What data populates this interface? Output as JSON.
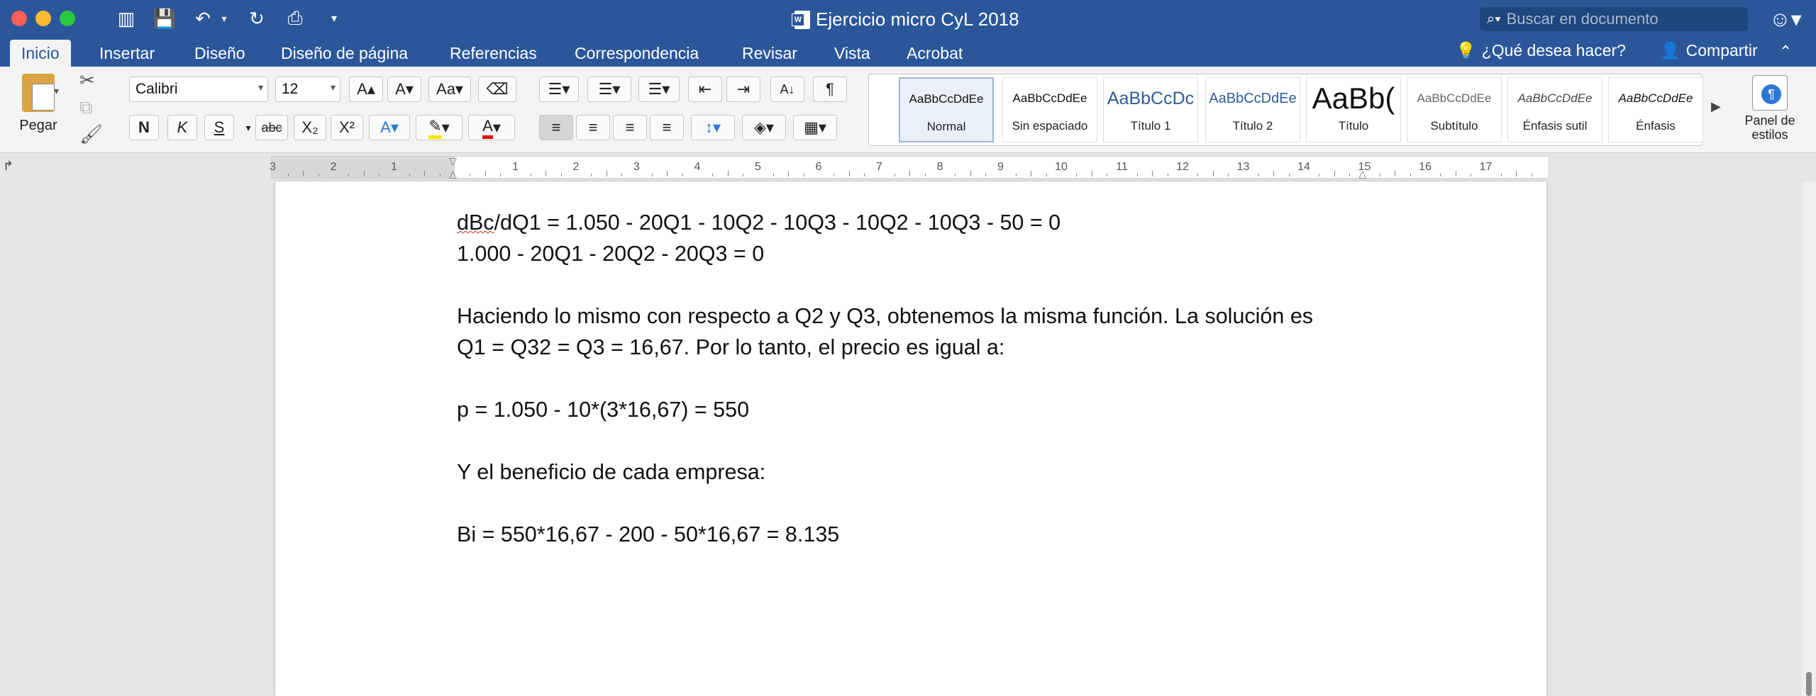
{
  "window": {
    "title": "Ejercicio micro CyL 2018"
  },
  "search": {
    "placeholder": "Buscar en documento"
  },
  "tabs": [
    {
      "label": "Inicio"
    },
    {
      "label": "Insertar"
    },
    {
      "label": "Diseño"
    },
    {
      "label": "Diseño de página"
    },
    {
      "label": "Referencias"
    },
    {
      "label": "Correspondencia"
    },
    {
      "label": "Revisar"
    },
    {
      "label": "Vista"
    },
    {
      "label": "Acrobat"
    }
  ],
  "tell_me": "¿Qué desea hacer?",
  "share": "Compartir",
  "ribbon": {
    "paste_label": "Pegar",
    "font_name": "Calibri",
    "font_size": "12",
    "bold": "N",
    "italic": "K",
    "underline": "S",
    "strike": "abc",
    "styles": [
      {
        "sample": "AaBbCcDdEe",
        "label": "Normal"
      },
      {
        "sample": "AaBbCcDdEe",
        "label": "Sin espaciado"
      },
      {
        "sample": "AaBbCcDc",
        "label": "Título 1"
      },
      {
        "sample": "AaBbCcDdEe",
        "label": "Título 2"
      },
      {
        "sample": "AaBb(",
        "label": "Título"
      },
      {
        "sample": "AaBbCcDdEe",
        "label": "Subtítulo"
      },
      {
        "sample": "AaBbCcDdEe",
        "label": "Énfasis sutil"
      },
      {
        "sample": "AaBbCcDdEe",
        "label": "Énfasis"
      }
    ],
    "styles_pane": "Panel de estilos"
  },
  "ruler": [
    "3",
    "2",
    "1",
    "",
    "1",
    "2",
    "3",
    "4",
    "5",
    "6",
    "7",
    "8",
    "9",
    "10",
    "11",
    "12",
    "13",
    "14",
    "15",
    "16",
    "17"
  ],
  "document": {
    "line1_word": "dBc",
    "line1_rest": "/dQ1 = 1.050 - 20Q1 - 10Q2 - 10Q3 - 10Q2 - 10Q3 - 50 = 0",
    "lines": [
      "1.000 - 20Q1 - 20Q2 - 20Q3 = 0",
      "",
      "Haciendo lo mismo con respecto a Q2 y Q3, obtenemos la misma función. La solución es",
      "Q1 = Q32 = Q3 = 16,67. Por lo tanto, el precio es igual a:",
      "",
      "p = 1.050 - 10*(3*16,67) = 550",
      "",
      "Y el beneficio de cada empresa:",
      "",
      "Bi = 550*16,67 - 200 - 50*16,67 = 8.135"
    ]
  },
  "colors": {
    "accent": "#2b579a"
  }
}
